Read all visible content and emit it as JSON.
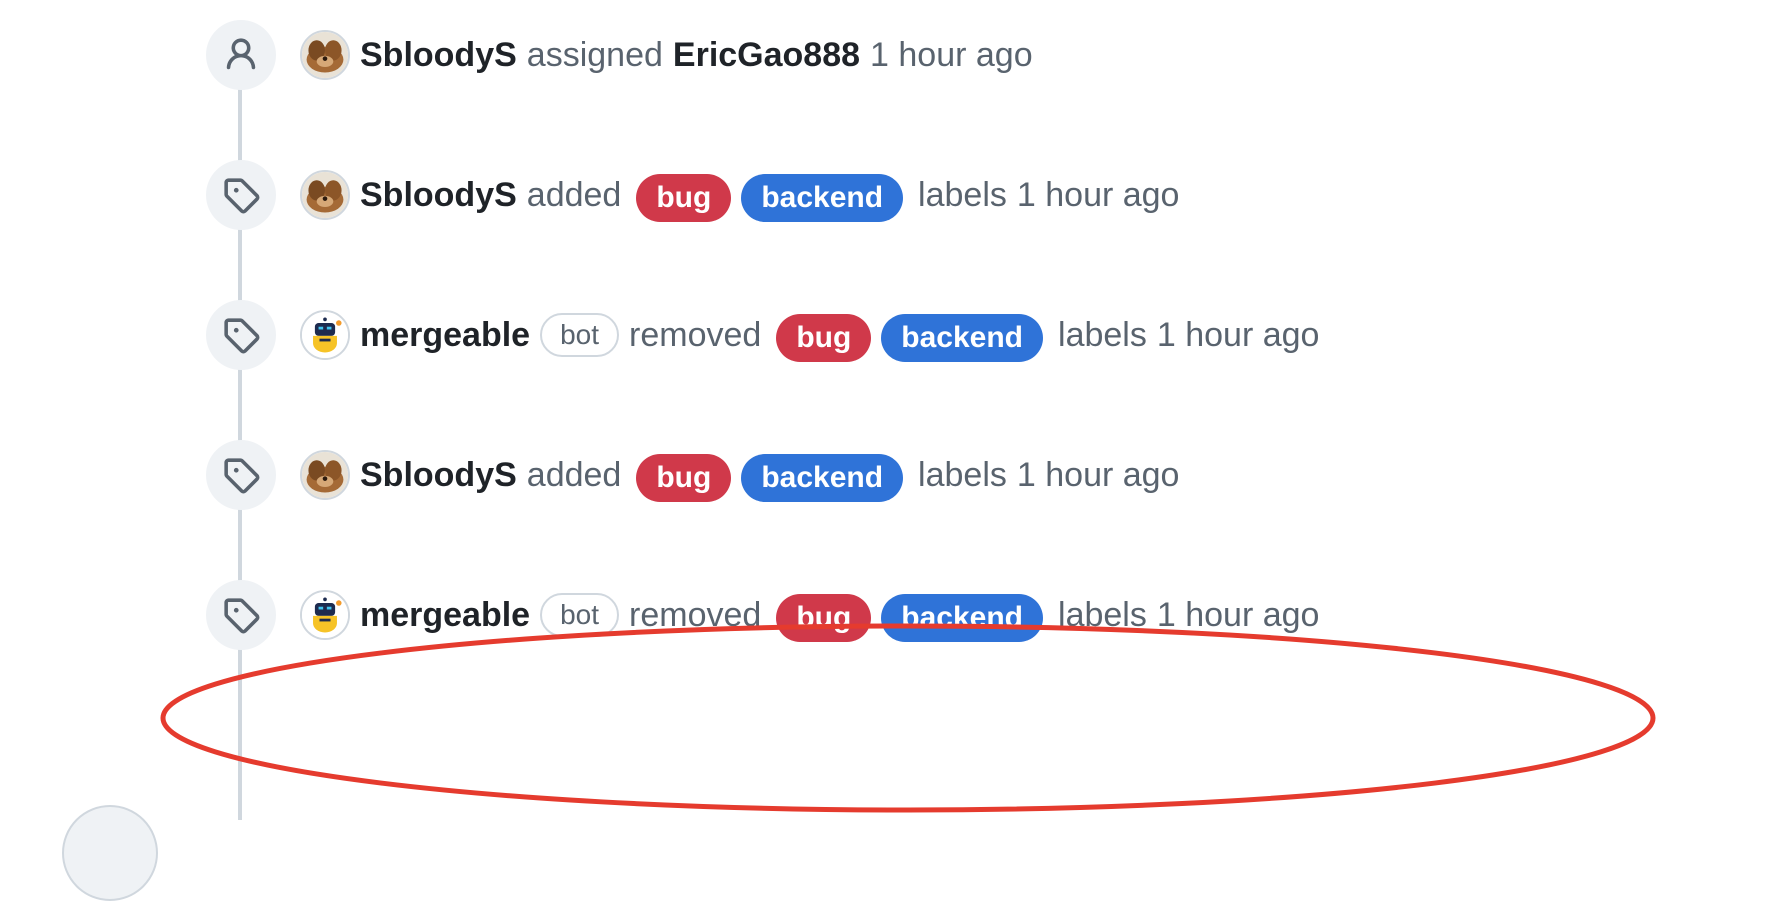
{
  "colors": {
    "bug_label": "#d0394a",
    "backend_label": "#2f73d8",
    "highlight": "#e53b2e",
    "timeline": "#d0d7de"
  },
  "events": [
    {
      "icon": "person-icon",
      "avatar": "dog-avatar",
      "actor": "SbloodyS",
      "action": "assigned",
      "assignee": "EricGao888",
      "time": "1 hour ago"
    },
    {
      "icon": "tag-icon",
      "avatar": "dog-avatar",
      "actor": "SbloodyS",
      "action": "added",
      "labels": [
        "bug",
        "backend"
      ],
      "labels_word": "labels",
      "time": "1 hour ago"
    },
    {
      "icon": "tag-icon",
      "avatar": "bot-avatar",
      "actor": "mergeable",
      "badge": "bot",
      "action": "removed",
      "labels": [
        "bug",
        "backend"
      ],
      "labels_word": "labels",
      "time": "1 hour ago"
    },
    {
      "icon": "tag-icon",
      "avatar": "dog-avatar",
      "actor": "SbloodyS",
      "action": "added",
      "labels": [
        "bug",
        "backend"
      ],
      "labels_word": "labels",
      "time": "1 hour ago"
    },
    {
      "icon": "tag-icon",
      "avatar": "bot-avatar",
      "actor": "mergeable",
      "badge": "bot",
      "action": "removed",
      "labels": [
        "bug",
        "backend"
      ],
      "labels_word": "labels",
      "time": "1 hour ago",
      "highlighted": true
    }
  ]
}
